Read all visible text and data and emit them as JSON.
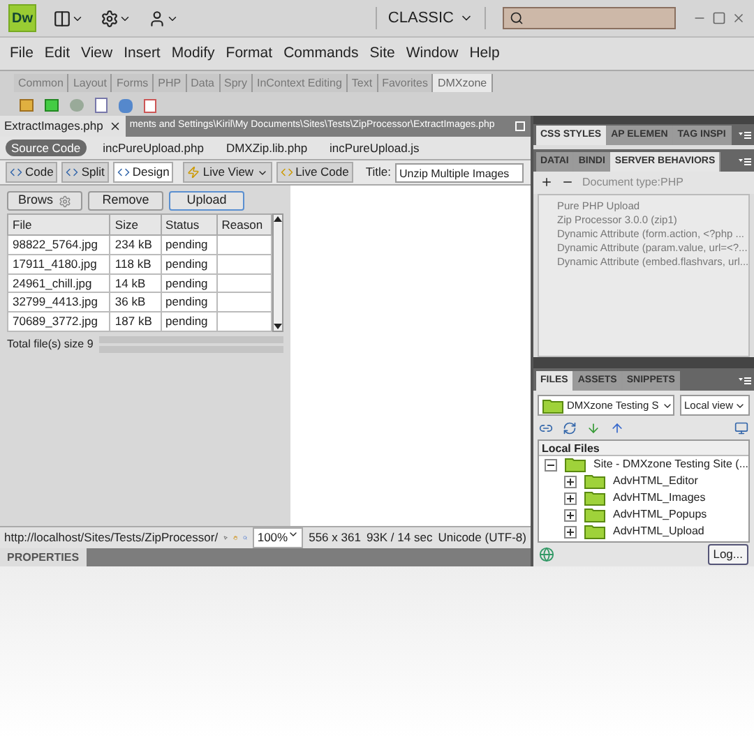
{
  "app": {
    "logo": "Dw",
    "workspace": "CLASSIC"
  },
  "menu": [
    "File",
    "Edit",
    "View",
    "Insert",
    "Modify",
    "Format",
    "Commands",
    "Site",
    "Window",
    "Help"
  ],
  "insert_tabs": [
    {
      "label": "Common",
      "selected": false
    },
    {
      "label": "Layout",
      "selected": false
    },
    {
      "label": "Forms",
      "selected": false
    },
    {
      "label": "PHP",
      "selected": false
    },
    {
      "label": "Data",
      "selected": false
    },
    {
      "label": "Spry",
      "selected": false
    },
    {
      "label": "InContext Editing",
      "selected": false
    },
    {
      "label": "Text",
      "selected": false
    },
    {
      "label": "Favorites",
      "selected": false
    },
    {
      "label": "DMXzone",
      "selected": true
    }
  ],
  "document_tab": {
    "label": "ExtractImages.php",
    "path": "ments and Settings\\Kiril\\My Documents\\Sites\\Tests\\ZipProcessor\\ExtractImages.php"
  },
  "related_files": [
    {
      "label": "Source Code",
      "selected": true
    },
    {
      "label": "incPureUpload.php",
      "selected": false
    },
    {
      "label": "DMXZip.lib.php",
      "selected": false
    },
    {
      "label": "incPureUpload.js",
      "selected": false
    }
  ],
  "view_buttons": [
    {
      "label": "Code",
      "selected": false
    },
    {
      "label": "Split",
      "selected": false
    },
    {
      "label": "Design",
      "selected": true
    }
  ],
  "live_view": "Live View",
  "live_code": "Live Code",
  "title_label": "Title:",
  "title_value": "Unzip Multiple Images",
  "uploader": {
    "buttons": [
      "Brows",
      "Remove",
      "Upload"
    ],
    "columns": [
      "File",
      "Size",
      "Status",
      "Reason"
    ],
    "rows": [
      [
        "98822_5764.jpg",
        "234 kB",
        "pending"
      ],
      [
        "17911_4180.jpg",
        "118 kB",
        "pending"
      ],
      [
        "24961_chill.jpg",
        "14 kB",
        "pending"
      ],
      [
        "32799_4413.jpg",
        "36 kB",
        "pending"
      ],
      [
        "70689_3772.jpg",
        "187 kB",
        "pending"
      ]
    ],
    "total": "Total file(s) size 9"
  },
  "status_bar": {
    "url": "http://localhost/Sites/Tests/ZipProcessor/",
    "zoom": "100%",
    "dimensions": "556 x 361",
    "download": "93K / 14 sec",
    "encoding": "Unicode (UTF-8)"
  },
  "properties": "PROPERTIES",
  "css_panel": {
    "tabs": [
      {
        "label": "CSS STYLES",
        "selected": true
      },
      {
        "label": "AP ELEMEN",
        "selected": false
      },
      {
        "label": "TAG INSPI",
        "selected": false
      }
    ]
  },
  "behaviors_panel": {
    "tabs": [
      {
        "label": "DATAI",
        "selected": false
      },
      {
        "label": "BINDI",
        "selected": false
      },
      {
        "label": "SERVER BEHAVIORS",
        "selected": true
      }
    ],
    "document_type": "Document type:PHP",
    "items": [
      "Pure PHP Upload",
      "Zip Processor 3.0.0 (zip1)",
      "Dynamic Attribute (form.action, <?php ...",
      "Dynamic Attribute (param.value, url=<?...",
      "Dynamic Attribute (embed.flashvars, url..."
    ]
  },
  "files_panel": {
    "tabs": [
      {
        "label": "FILES",
        "selected": true
      },
      {
        "label": "ASSETS",
        "selected": false
      },
      {
        "label": "SNIPPETS",
        "selected": false
      }
    ],
    "site": "DMXzone Testing S",
    "view": "Local view",
    "header": "Local Files",
    "tree": [
      {
        "label": "Site - DMXzone Testing Site (...",
        "expanded": true,
        "children": [
          {
            "label": "AdvHTML_Editor",
            "expanded": false
          },
          {
            "label": "AdvHTML_Images",
            "expanded": false
          },
          {
            "label": "AdvHTML_Popups",
            "expanded": false
          },
          {
            "label": "AdvHTML_Upload",
            "expanded": false
          }
        ]
      }
    ],
    "log_button": "Log..."
  }
}
